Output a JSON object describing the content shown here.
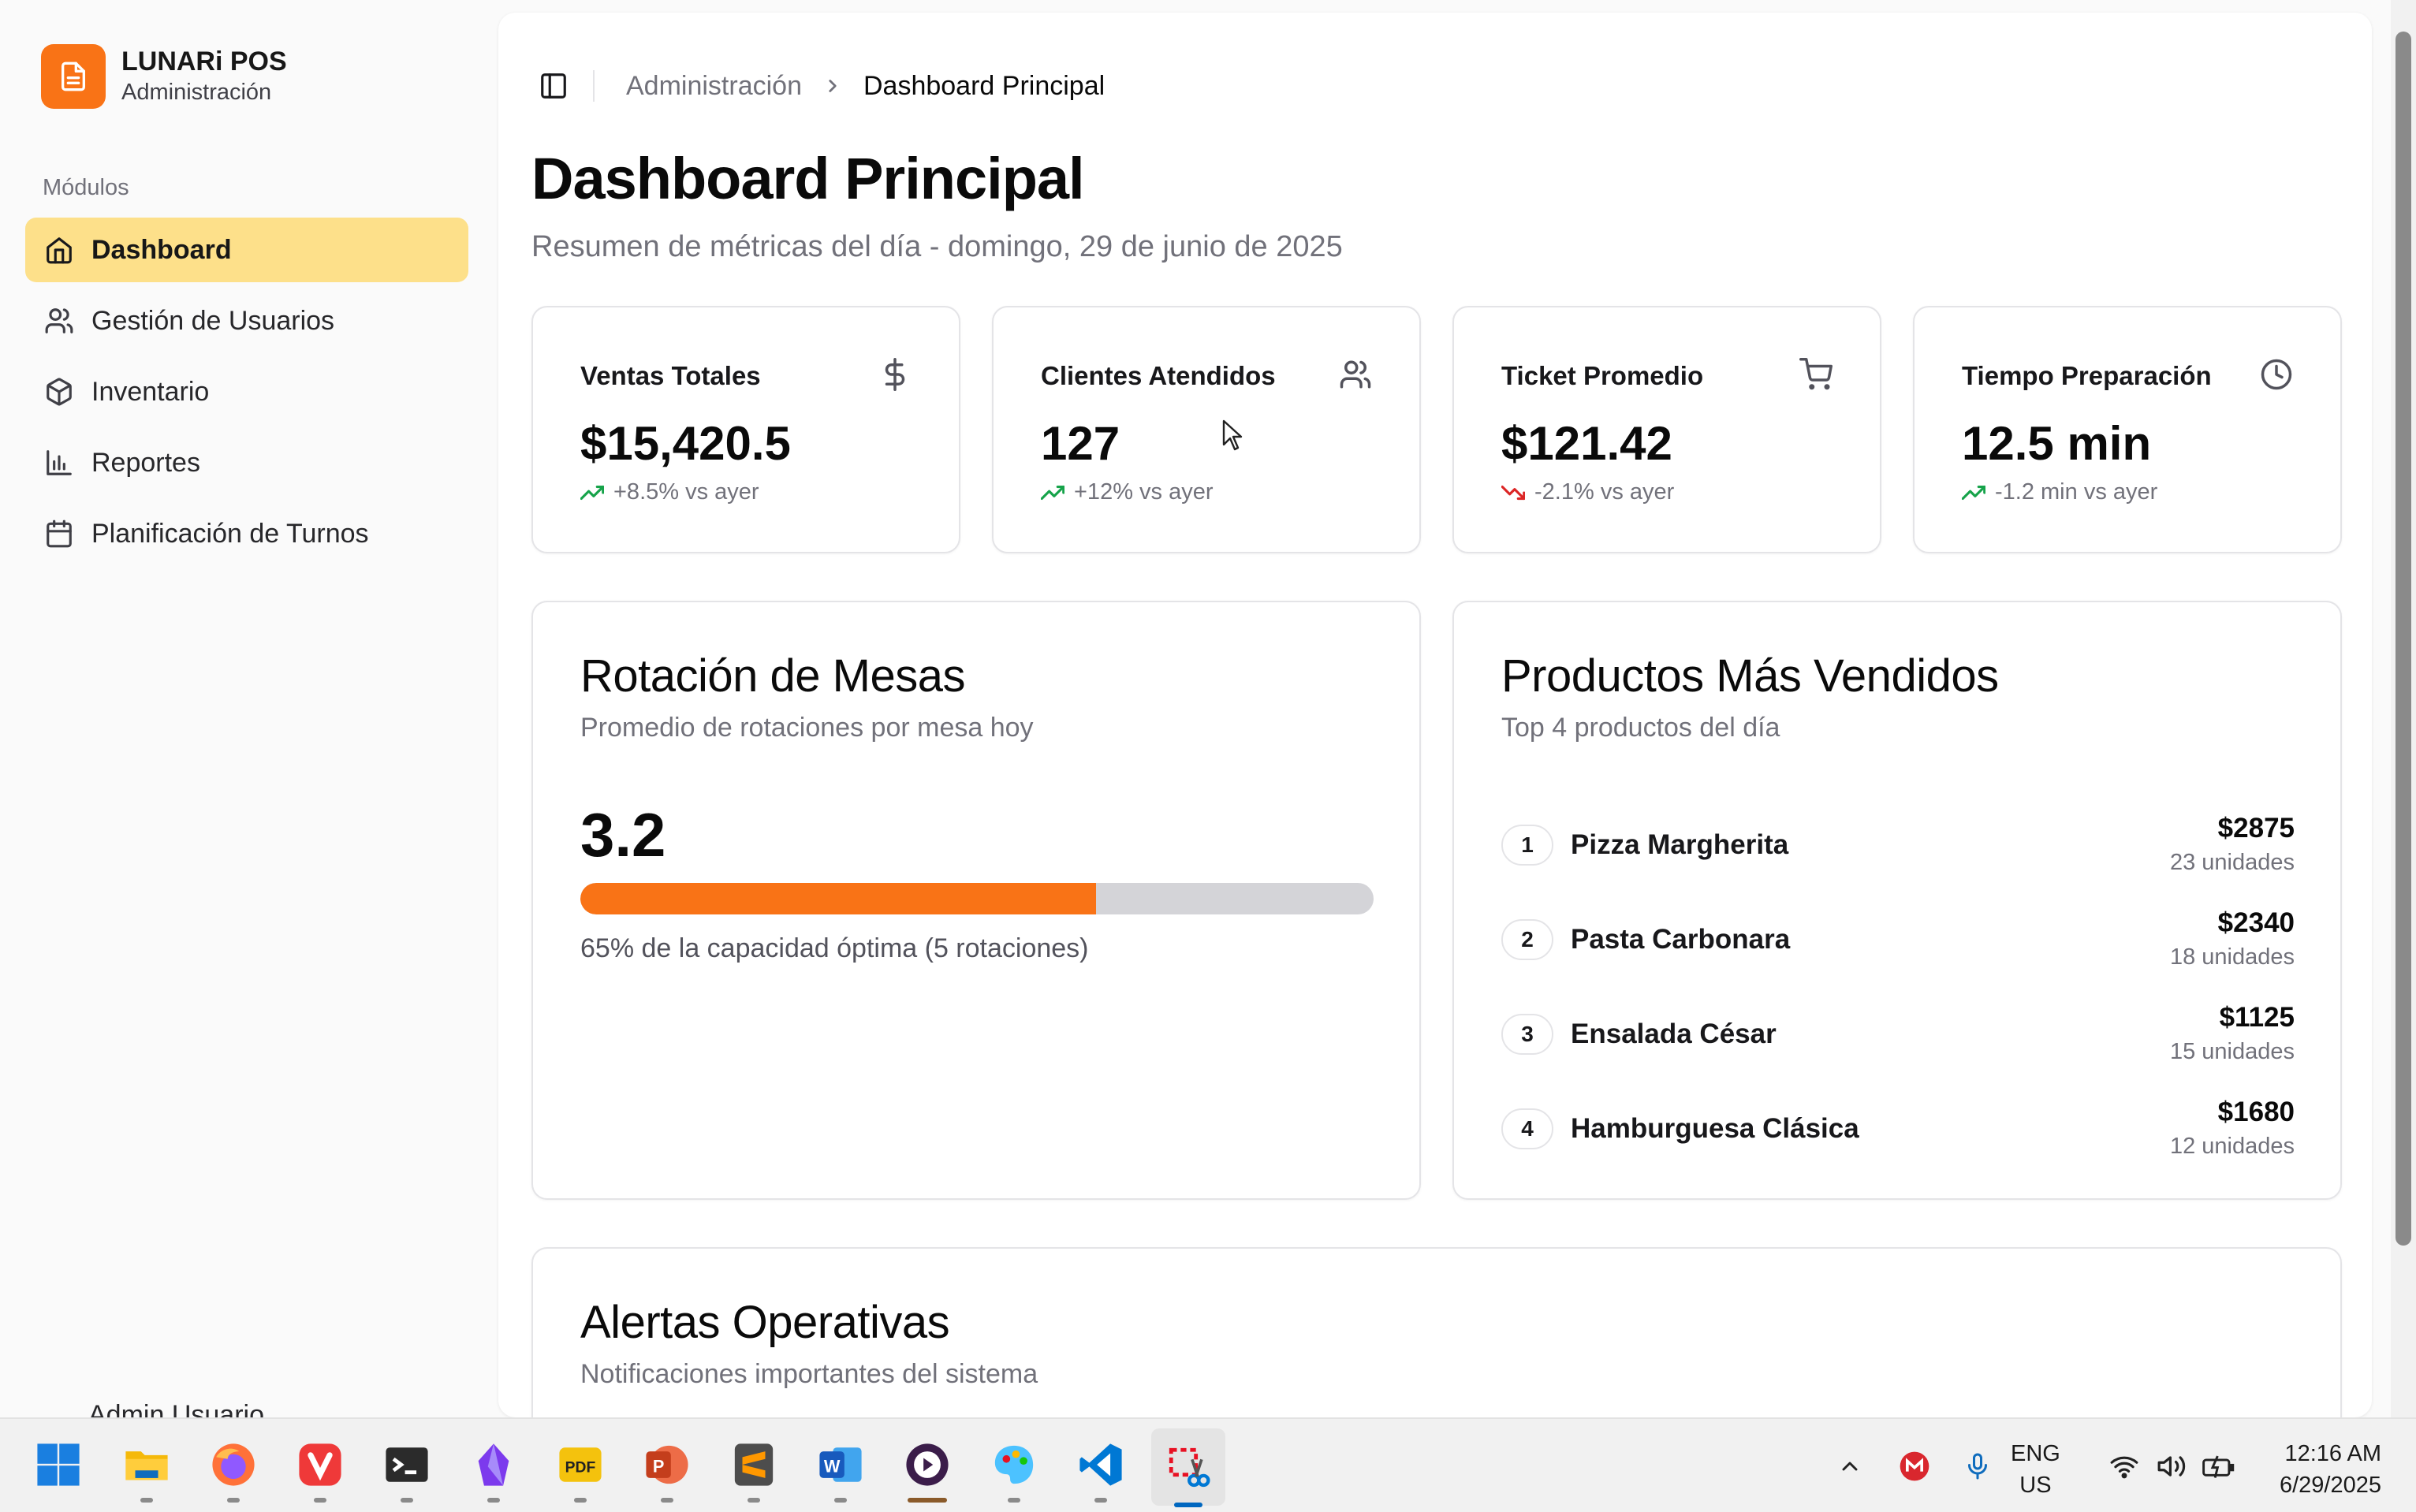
{
  "sidebar": {
    "brand": {
      "name": "LUNARi POS",
      "subtitle": "Administración"
    },
    "group_label": "Módulos",
    "items": [
      {
        "label": "Dashboard",
        "icon": "home-icon",
        "active": true
      },
      {
        "label": "Gestión de Usuarios",
        "icon": "users-icon"
      },
      {
        "label": "Inventario",
        "icon": "package-icon"
      },
      {
        "label": "Reportes",
        "icon": "bar-chart-icon"
      },
      {
        "label": "Planificación de Turnos",
        "icon": "calendar-icon"
      }
    ],
    "user_label": "Admin Usuario"
  },
  "breadcrumb": {
    "parent": "Administración",
    "current": "Dashboard Principal"
  },
  "page": {
    "title": "Dashboard Principal",
    "subtitle": "Resumen de métricas del día - domingo, 29 de junio de 2025"
  },
  "metrics": [
    {
      "label": "Ventas Totales",
      "value": "$15,420.5",
      "delta": "+8.5% vs ayer",
      "trend": "up",
      "icon": "dollar-icon"
    },
    {
      "label": "Clientes Atendidos",
      "value": "127",
      "delta": "+12% vs ayer",
      "trend": "up",
      "icon": "users-icon"
    },
    {
      "label": "Ticket Promedio",
      "value": "$121.42",
      "delta": "-2.1% vs ayer",
      "trend": "down",
      "icon": "cart-icon"
    },
    {
      "label": "Tiempo Preparación",
      "value": "12.5 min",
      "delta": "-1.2 min vs ayer",
      "trend": "up",
      "icon": "clock-icon"
    }
  ],
  "rotation": {
    "title": "Rotación de Mesas",
    "subtitle": "Promedio de rotaciones por mesa hoy",
    "value": "3.2",
    "progress_percent": 65,
    "caption": "65% de la capacidad óptima (5 rotaciones)"
  },
  "top_products": {
    "title": "Productos Más Vendidos",
    "subtitle": "Top 4 productos del día",
    "items": [
      {
        "rank": "1",
        "name": "Pizza Margherita",
        "price": "$2875",
        "units": "23 unidades"
      },
      {
        "rank": "2",
        "name": "Pasta Carbonara",
        "price": "$2340",
        "units": "18 unidades"
      },
      {
        "rank": "3",
        "name": "Ensalada César",
        "price": "$1125",
        "units": "15 unidades"
      },
      {
        "rank": "4",
        "name": "Hamburguesa Clásica",
        "price": "$1680",
        "units": "12 unidades"
      }
    ]
  },
  "alerts": {
    "title": "Alertas Operativas",
    "subtitle": "Notificaciones importantes del sistema"
  },
  "taskbar": {
    "lang_line1": "ENG",
    "lang_line2": "US",
    "time": "12:16 AM",
    "date": "6/29/2025"
  },
  "colors": {
    "accent": "#f97316",
    "active_nav": "#fde08a",
    "trend_up": "#16a34a",
    "trend_down": "#dc2626"
  }
}
